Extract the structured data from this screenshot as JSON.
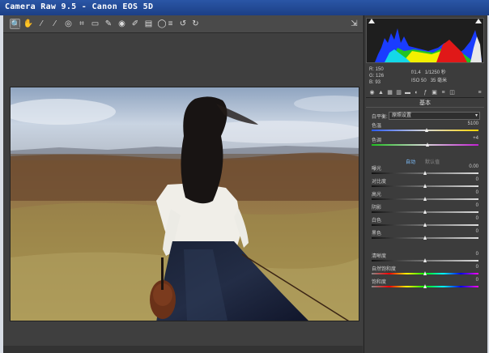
{
  "window": {
    "title": "Camera Raw 9.5 -  Canon EOS 5D"
  },
  "toolbar": {
    "tools": [
      {
        "name": "zoom-tool",
        "icon": "search-icon",
        "glyph": "🔍"
      },
      {
        "name": "hand-tool",
        "icon": "hand-icon",
        "glyph": "✋"
      },
      {
        "name": "white-balance-tool",
        "icon": "eyedropper-icon",
        "glyph": "⁄"
      },
      {
        "name": "color-sampler-tool",
        "icon": "color-sampler-icon",
        "glyph": "⁄"
      },
      {
        "name": "targeted-adjustment-tool",
        "icon": "target-icon",
        "glyph": "◎"
      },
      {
        "name": "crop-tool",
        "icon": "crop-icon",
        "glyph": "⌗"
      },
      {
        "name": "straighten-tool",
        "icon": "straighten-icon",
        "glyph": "▭"
      },
      {
        "name": "spot-removal-tool",
        "icon": "brush-icon",
        "glyph": "✎"
      },
      {
        "name": "red-eye-tool",
        "icon": "eye-icon",
        "glyph": "◉"
      },
      {
        "name": "adjustment-brush-tool",
        "icon": "brush-icon",
        "glyph": "✐"
      },
      {
        "name": "graduated-filter-tool",
        "icon": "gradient-icon",
        "glyph": "▤"
      },
      {
        "name": "radial-filter-tool",
        "icon": "ellipse-icon",
        "glyph": "◯"
      },
      {
        "name": "preferences-list-tool",
        "icon": "list-icon",
        "glyph": "≡"
      },
      {
        "name": "rotate-left-tool",
        "icon": "rotate-left-icon",
        "glyph": "↺"
      },
      {
        "name": "rotate-right-tool",
        "icon": "rotate-right-icon",
        "glyph": "↻"
      }
    ],
    "prefs_glyph": "⇲"
  },
  "histogram": {
    "colors": {
      "red": "#e01818",
      "green": "#22c422",
      "blue": "#1a3cff",
      "yellow": "#f2f000",
      "cyan": "#14d8e8",
      "white": "#e8e8e8"
    }
  },
  "readout": {
    "r_label": "R:",
    "r_value": "150",
    "g_label": "G:",
    "g_value": "126",
    "b_label": "B:",
    "b_value": "93",
    "exposure": "f/1.4",
    "shutter": "1/1250 秒",
    "iso": "ISO 50",
    "focal": "35 毫米"
  },
  "panel_tabs": [
    "basic",
    "tone-curve",
    "detail",
    "hsl",
    "split-toning",
    "lens",
    "effects",
    "camera-calibration",
    "presets",
    "snapshots"
  ],
  "basic": {
    "title": "基本",
    "white_balance_label": "白平衡:",
    "white_balance_value": "原照设置",
    "auto_label": "自动",
    "default_label": "默认值",
    "sliders": [
      {
        "key": "temperature",
        "label": "色温",
        "value": "5100",
        "pos": 0.52,
        "track": "temp"
      },
      {
        "key": "tint",
        "label": "色调",
        "value": "+4",
        "pos": 0.53,
        "track": "tint"
      },
      {
        "key": "exposure",
        "label": "曝光",
        "value": "0.00",
        "pos": 0.5,
        "track": "plain"
      },
      {
        "key": "contrast",
        "label": "对比度",
        "value": "0",
        "pos": 0.5,
        "track": "plain"
      },
      {
        "key": "highlights",
        "label": "高光",
        "value": "0",
        "pos": 0.5,
        "track": "plain"
      },
      {
        "key": "shadows",
        "label": "阴影",
        "value": "0",
        "pos": 0.5,
        "track": "plain"
      },
      {
        "key": "whites",
        "label": "白色",
        "value": "0",
        "pos": 0.5,
        "track": "plain"
      },
      {
        "key": "blacks",
        "label": "黑色",
        "value": "0",
        "pos": 0.5,
        "track": "plain"
      },
      {
        "key": "clarity",
        "label": "清晰度",
        "value": "0",
        "pos": 0.5,
        "track": "plain"
      },
      {
        "key": "vibrance",
        "label": "自然饱和度",
        "value": "0",
        "pos": 0.5,
        "track": "sat"
      },
      {
        "key": "saturation",
        "label": "饱和度",
        "value": "0",
        "pos": 0.5,
        "track": "sat"
      }
    ]
  }
}
